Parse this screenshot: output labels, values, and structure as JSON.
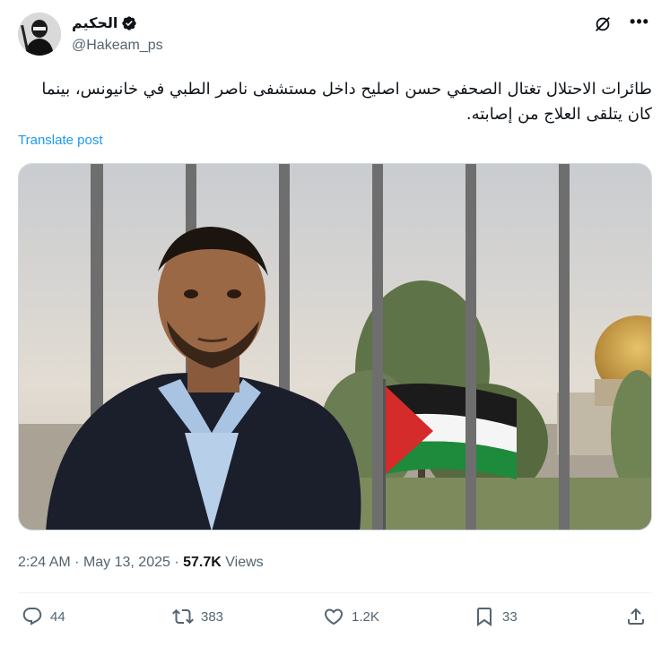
{
  "author": {
    "display_name": "الحكيم",
    "handle": "@Hakeam_ps",
    "verified": true,
    "avatar_icon": "avatar-silhouette-icon"
  },
  "header_icons": {
    "grok": "grok-icon",
    "more": "•••"
  },
  "tweet": {
    "text": "طائرات الاحتلال تغتال الصحفي حسن اصليح داخل مستشفى ناصر الطبي في خانيونس، بينما كان يتلقى العلاج من إصابته.",
    "translate_label": "Translate post"
  },
  "meta": {
    "time": "2:24 AM",
    "separator": "·",
    "date": "May 13, 2025",
    "views_count": "57.7K",
    "views_label": "Views"
  },
  "actions": {
    "replies": "44",
    "reposts": "383",
    "likes": "1.2K",
    "bookmarks": "33"
  },
  "colors": {
    "link": "#1d9bf0",
    "secondary_text": "#536471",
    "primary_text": "#0f1419",
    "border": "#eff3f4"
  }
}
